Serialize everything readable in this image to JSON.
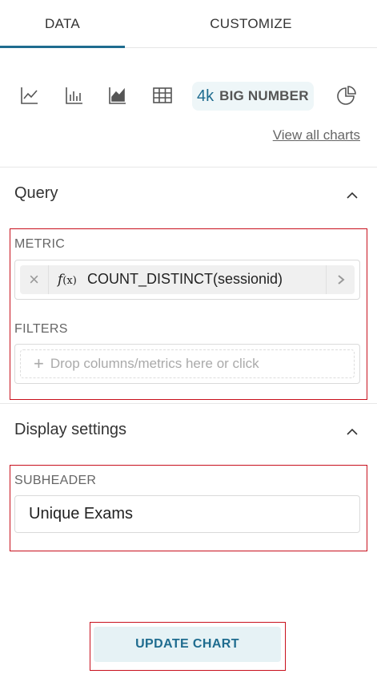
{
  "tabs": [
    {
      "label": "DATA",
      "active": true
    },
    {
      "label": "CUSTOMIZE",
      "active": false
    }
  ],
  "chart_types": {
    "icons": [
      "line-chart-icon",
      "bar-chart-icon",
      "area-chart-icon",
      "table-icon",
      "big-number-icon",
      "pie-chart-icon"
    ],
    "selected": {
      "glyph": "4k",
      "label": "BIG NUMBER"
    },
    "view_all_label": "View all charts"
  },
  "query": {
    "title": "Query",
    "metric_label": "METRIC",
    "metric": {
      "fx_main": "f",
      "fx_paren": "(x)",
      "value": "COUNT_DISTINCT(sessionid)"
    },
    "filters_label": "FILTERS",
    "filters_placeholder": "Drop columns/metrics here or click"
  },
  "display_settings": {
    "title": "Display settings",
    "subheader_label": "SUBHEADER",
    "subheader_value": "Unique Exams"
  },
  "update_button_label": "UPDATE CHART",
  "colors": {
    "accent": "#1f6c8f",
    "highlight": "#c8101d",
    "selected_bg": "#eef6f8"
  }
}
